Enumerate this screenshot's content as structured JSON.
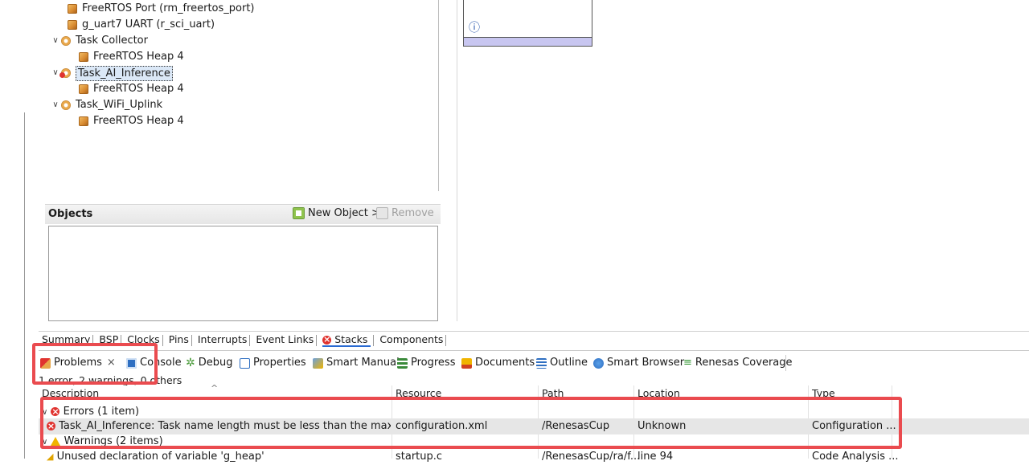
{
  "tree": {
    "items": [
      {
        "label": "FreeRTOS Port (rm_freertos_port)",
        "icon": "module-icon"
      },
      {
        "label": "g_uart7 UART (r_sci_uart)",
        "icon": "module-icon"
      },
      {
        "label": "Task Collector",
        "icon": "thread-icon"
      },
      {
        "label": "FreeRTOS Heap 4",
        "icon": "module-icon"
      },
      {
        "label": "Task_AI_Inference",
        "icon": "thread-error-icon"
      },
      {
        "label": "FreeRTOS Heap 4",
        "icon": "module-icon"
      },
      {
        "label": "Task_WiFi_Uplink",
        "icon": "thread-icon"
      },
      {
        "label": "FreeRTOS Heap 4",
        "icon": "module-icon"
      }
    ]
  },
  "objects": {
    "title": "Objects",
    "new_object": "New Object >",
    "remove": "Remove"
  },
  "info_icon": "ⓘ",
  "config_tabs": [
    "Summary",
    "BSP",
    "Clocks",
    "Pins",
    "Interrupts",
    "Event Links",
    "Stacks",
    "Components"
  ],
  "views": {
    "problems": "Problems",
    "console": "Console",
    "debug": "Debug",
    "properties": "Properties",
    "smart_manual": "Smart Manual",
    "progress": "Progress",
    "documents": "Documents",
    "outline": "Outline",
    "smart_browser": "Smart Browser",
    "renesas_coverage": "Renesas Coverage"
  },
  "problems": {
    "summary": "1 error, 2 warnings, 0 others",
    "columns": {
      "description": "Description",
      "resource": "Resource",
      "path": "Path",
      "location": "Location",
      "type": "Type"
    },
    "errors_group": "Errors (1 item)",
    "error_row": {
      "description": "Task_AI_Inference: Task name length must be less than the max tas",
      "resource": "configuration.xml",
      "path": "/RenesasCup",
      "location": "Unknown",
      "type": "Configuration ..."
    },
    "warnings_group": "Warnings (2 items)",
    "warning_row": {
      "description": "Unused declaration of variable 'g_heap'",
      "resource": "startup.c",
      "path": "/RenesasCup/ra/f...",
      "location": "line 94",
      "type": "Code Analysis ..."
    }
  }
}
